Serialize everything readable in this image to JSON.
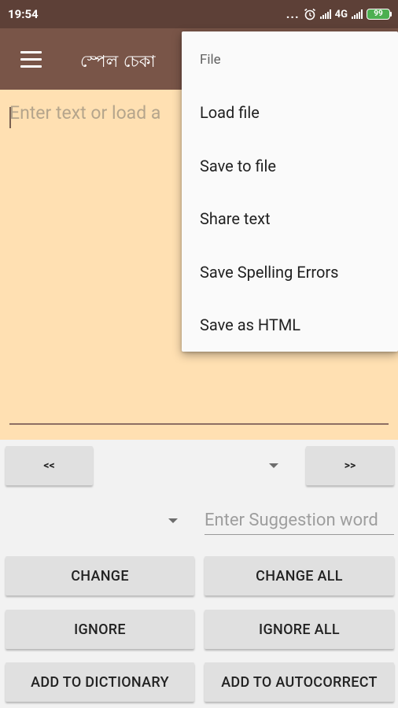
{
  "status_bar": {
    "time": "19:54",
    "dots": "...",
    "network": "4G",
    "battery": "99",
    "alarm_icon": "alarm-icon"
  },
  "app_bar": {
    "menu_icon": "hamburger-menu-icon",
    "title": "স্পেল চেকা"
  },
  "editor": {
    "placeholder": "Enter text or load a",
    "value": ""
  },
  "navigation": {
    "prev_label": "<<",
    "next_label": ">>",
    "error_word_selected": ""
  },
  "suggestion": {
    "selected": "",
    "placeholder": "Enter Suggestion word",
    "value": ""
  },
  "actions": {
    "change": "CHANGE",
    "change_all": "CHANGE ALL",
    "ignore": "IGNORE",
    "ignore_all": "IGNORE ALL",
    "add_to_dictionary": "ADD TO DICTIONARY",
    "add_to_autocorrect": "ADD TO AUTOCORRECT"
  },
  "file_menu": {
    "header": "File",
    "items": [
      {
        "label": "Load file"
      },
      {
        "label": "Save to file"
      },
      {
        "label": "Share text"
      },
      {
        "label": "Save Spelling Errors"
      },
      {
        "label": "Save as HTML"
      }
    ]
  },
  "colors": {
    "status_bar": "#5d4037",
    "app_bar": "#795548",
    "editor_bg": "#ffe0b2",
    "battery_fill": "#4caf50",
    "button_bg": "#e0e0e0"
  }
}
